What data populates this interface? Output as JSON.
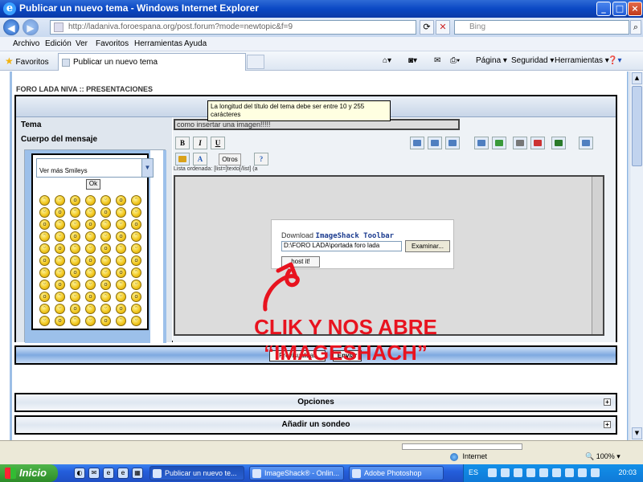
{
  "window": {
    "title": "Publicar un nuevo tema - Windows Internet Explorer"
  },
  "address": {
    "url": "http://ladaniva.foroespana.org/post.forum?mode=newtopic&f=9",
    "search_placeholder": "Bing"
  },
  "menu": [
    "Archivo",
    "Edición",
    "Ver",
    "Favoritos",
    "Herramientas",
    "Ayuda"
  ],
  "favbar": {
    "favorites_label": "Favoritos",
    "tab_label": "Publicar un nuevo tema",
    "page_menu": "Página",
    "safety_menu": "Seguridad",
    "tools_menu": "Herramientas"
  },
  "forum": {
    "breadcrumb": "FORO LADA NIVA :: PRESENTACIONES",
    "form_title": "Publicar un nuevo tema",
    "subject_label": "Tema",
    "subject_value": "como insertar una imagen!!!!!",
    "body_label": "Cuerpo del mensaje",
    "tooltip": "La longitud del título del tema debe ser entre 10 y 255 carácteres",
    "smiley_select": "Ver más Smileys",
    "ok_label": "Ok",
    "otros_label": "Otros",
    "list_hint": "Lista ordenada: [list=]texto[/list] (a",
    "toolbar": {
      "bold": "B",
      "italic": "I",
      "underline": "U"
    },
    "preview_button": "Previsualizar",
    "submit_button": "Enviar",
    "options_section": "Opciones",
    "poll_section": "Añadir un sondeo"
  },
  "imageshack": {
    "download_text": "Download",
    "toolbar_name": "ImageShack Toolbar",
    "path_value": "D:\\FORO LADA\\portada foro lada",
    "browse_button": "Examinar...",
    "host_button": "host it!"
  },
  "annotation": {
    "line1": "CLIK Y NOS ABRE",
    "line2": "“IMAGESHACH”",
    "color": "#e8131f"
  },
  "statusbar": {
    "zone": "Internet",
    "zoom": "100%"
  },
  "taskbar": {
    "start_label": "Inicio",
    "tasks": [
      "Publicar un nuevo te...",
      "ImageShack® - Onlin...",
      "Adobe Photoshop"
    ],
    "language": "ES",
    "clock": "20:03"
  }
}
